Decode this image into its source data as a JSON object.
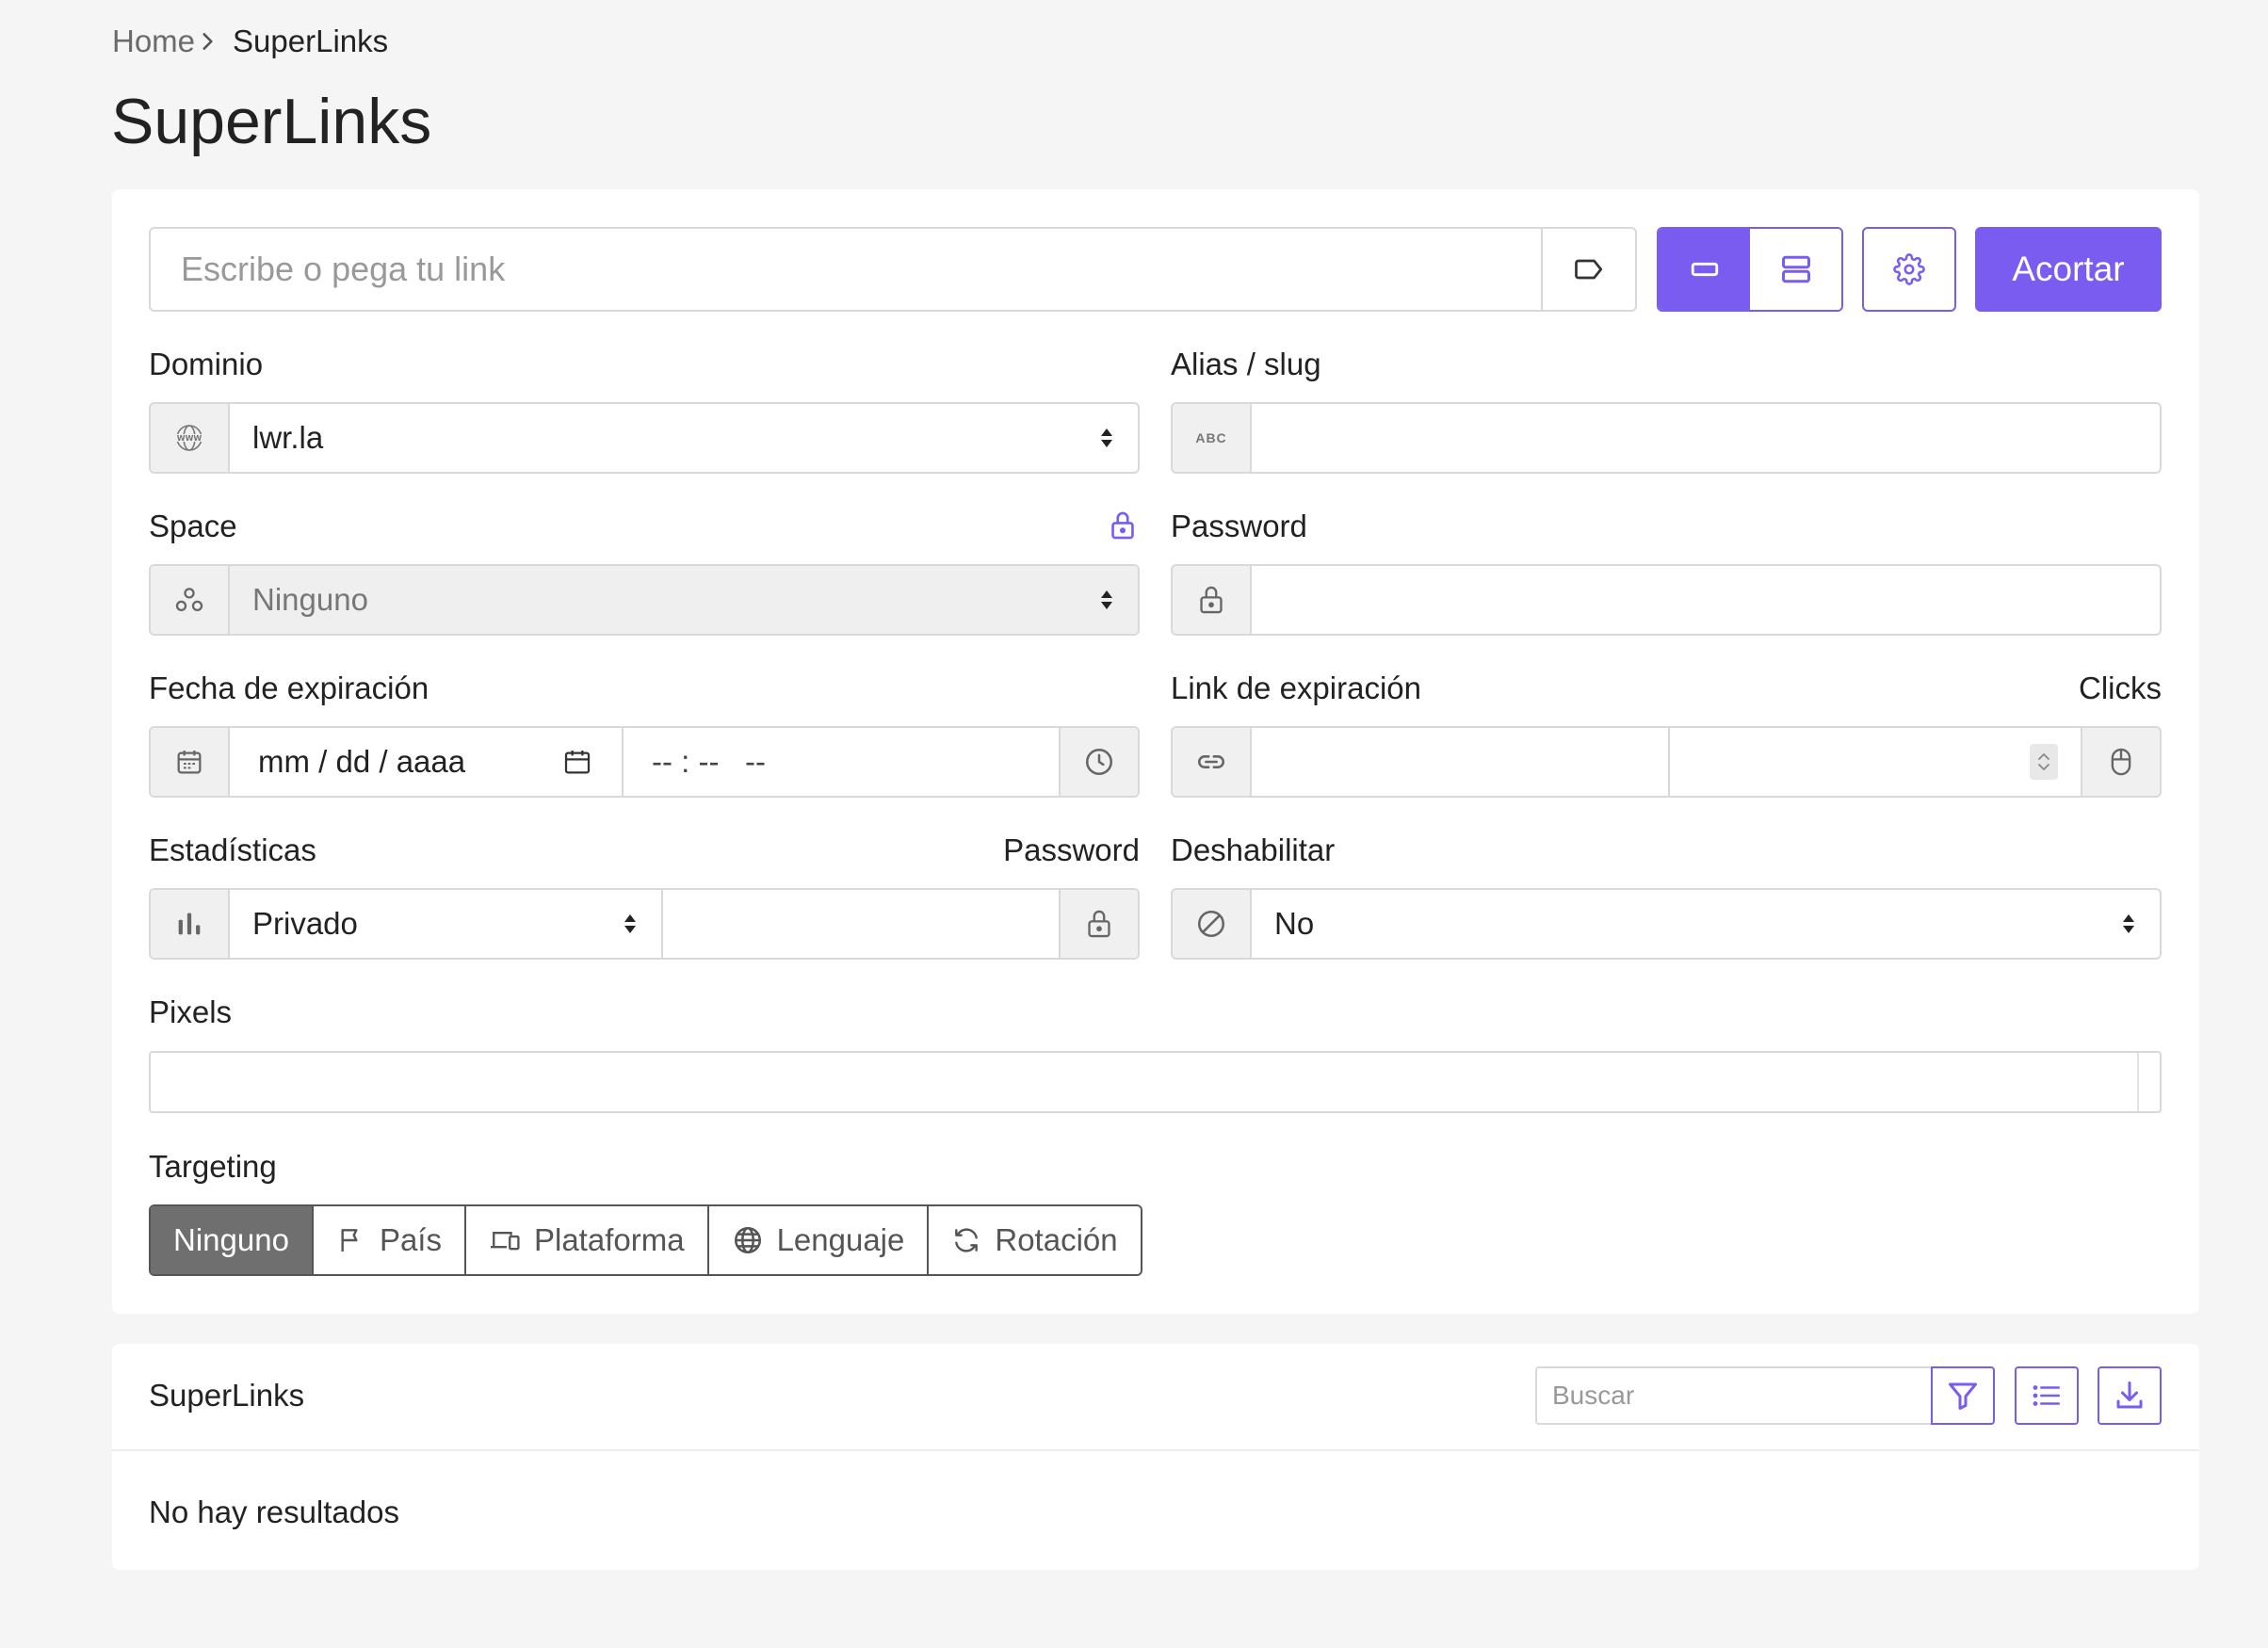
{
  "breadcrumb": {
    "home": "Home",
    "current": "SuperLinks"
  },
  "page_title": "SuperLinks",
  "url_input": {
    "placeholder": "Escribe o pega tu link"
  },
  "shorten_button": "Acortar",
  "fields": {
    "domain": {
      "label": "Dominio",
      "value": "lwr.la",
      "icon_text": "WWW"
    },
    "alias": {
      "label": "Alias / slug",
      "value": "",
      "icon_text": "ABC"
    },
    "space": {
      "label": "Space",
      "value": "Ninguno"
    },
    "password": {
      "label": "Password",
      "value": ""
    },
    "expiration_date": {
      "label": "Fecha de expiración",
      "date_placeholder": "mm / dd / aaaa",
      "time_placeholder": "-- : --   --"
    },
    "expiration_link": {
      "label": "Link de expiración",
      "value": ""
    },
    "clicks": {
      "label": "Clicks",
      "value": ""
    },
    "statistics": {
      "label": "Estadísticas",
      "value": "Privado"
    },
    "stats_password": {
      "label": "Password",
      "value": ""
    },
    "disable": {
      "label": "Deshabilitar",
      "value": "No"
    },
    "pixels": {
      "label": "Pixels"
    },
    "targeting": {
      "label": "Targeting"
    }
  },
  "targeting_tabs": [
    "Ninguno",
    "País",
    "Plataforma",
    "Lenguaje",
    "Rotación"
  ],
  "list": {
    "title": "SuperLinks",
    "search_placeholder": "Buscar",
    "empty_message": "No hay resultados"
  },
  "colors": {
    "accent": "#7b5cf0",
    "background": "#f5f5f5",
    "active_tab": "#6f6f6f"
  }
}
